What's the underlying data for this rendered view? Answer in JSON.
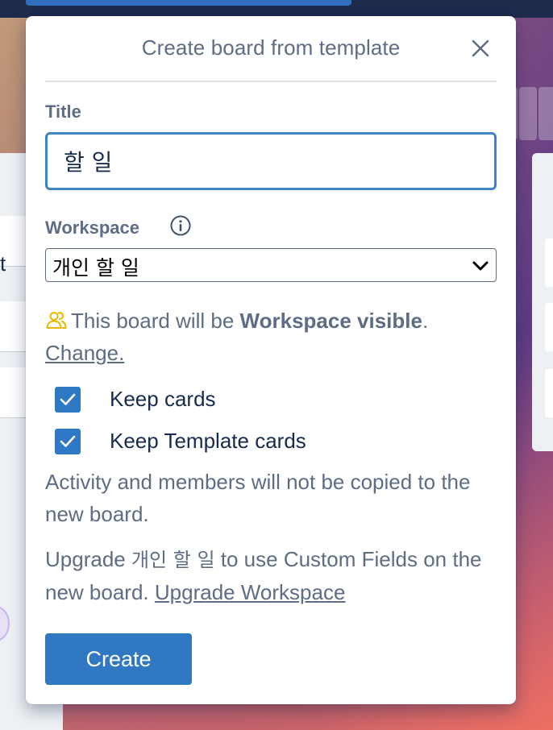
{
  "modal": {
    "title": "Create board from template",
    "title_label": "Title",
    "title_value": "할 일",
    "workspace_label": "Workspace",
    "workspace_selected": "개인 할 일",
    "visibility_prefix": "This board will be ",
    "visibility_bold": "Workspace visible",
    "visibility_suffix": ".",
    "change_link": "Change.",
    "checkboxes": [
      {
        "label": "Keep cards",
        "checked": true
      },
      {
        "label": "Keep Template cards",
        "checked": true
      }
    ],
    "activity_note": "Activity and members will not be copied to the new board.",
    "upgrade_prefix": "Upgrade ",
    "upgrade_workspace_name": "개인 할 일",
    "upgrade_suffix": " to use Custom Fields on the new board. ",
    "upgrade_link": "Upgrade Workspace",
    "create_button": "Create"
  },
  "background": {
    "list_card_letter": "t"
  },
  "colors": {
    "accent": "#3178c2",
    "input_border": "#3f83c8",
    "muted_text": "#5e6c84",
    "visibility_icon": "#e6b800"
  }
}
